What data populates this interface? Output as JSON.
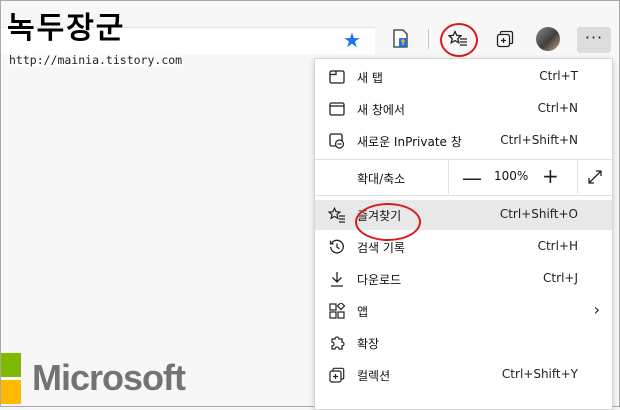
{
  "watermark": {
    "title": "녹두장군",
    "url": "http://mainia.tistory.com"
  },
  "toolbar": {
    "favorite_icon": "star-filled-icon",
    "extension_icon": "extension-icon",
    "favorites_icon": "favorites-list-icon",
    "collections_icon": "collections-icon",
    "more_label": "···"
  },
  "menu": {
    "items": [
      {
        "label": "새 탭",
        "shortcut": "Ctrl+T",
        "icon": "new-tab-icon"
      },
      {
        "label": "새 창에서",
        "shortcut": "Ctrl+N",
        "icon": "new-window-icon"
      },
      {
        "label": "새로운 InPrivate 창",
        "shortcut": "Ctrl+Shift+N",
        "icon": "inprivate-icon"
      },
      {
        "label": "즐겨찾기",
        "shortcut": "Ctrl+Shift+O",
        "icon": "favorites-icon"
      },
      {
        "label": "검색 기록",
        "shortcut": "Ctrl+H",
        "icon": "history-icon"
      },
      {
        "label": "다운로드",
        "shortcut": "Ctrl+J",
        "icon": "download-icon"
      },
      {
        "label": "앱",
        "shortcut": "",
        "icon": "apps-icon"
      },
      {
        "label": "확장",
        "shortcut": "",
        "icon": "extensions-icon"
      },
      {
        "label": "컬렉션",
        "shortcut": "Ctrl+Shift+Y",
        "icon": "collections-icon"
      }
    ],
    "zoom": {
      "label": "확대/축소",
      "minus": "—",
      "value": "100%",
      "plus": "+"
    }
  },
  "logo": {
    "text": "Microsoft"
  },
  "colors": {
    "accent": "#1a73e8",
    "highlight_ring": "#d61c1c",
    "menu_hover": "#e8e8e8"
  }
}
